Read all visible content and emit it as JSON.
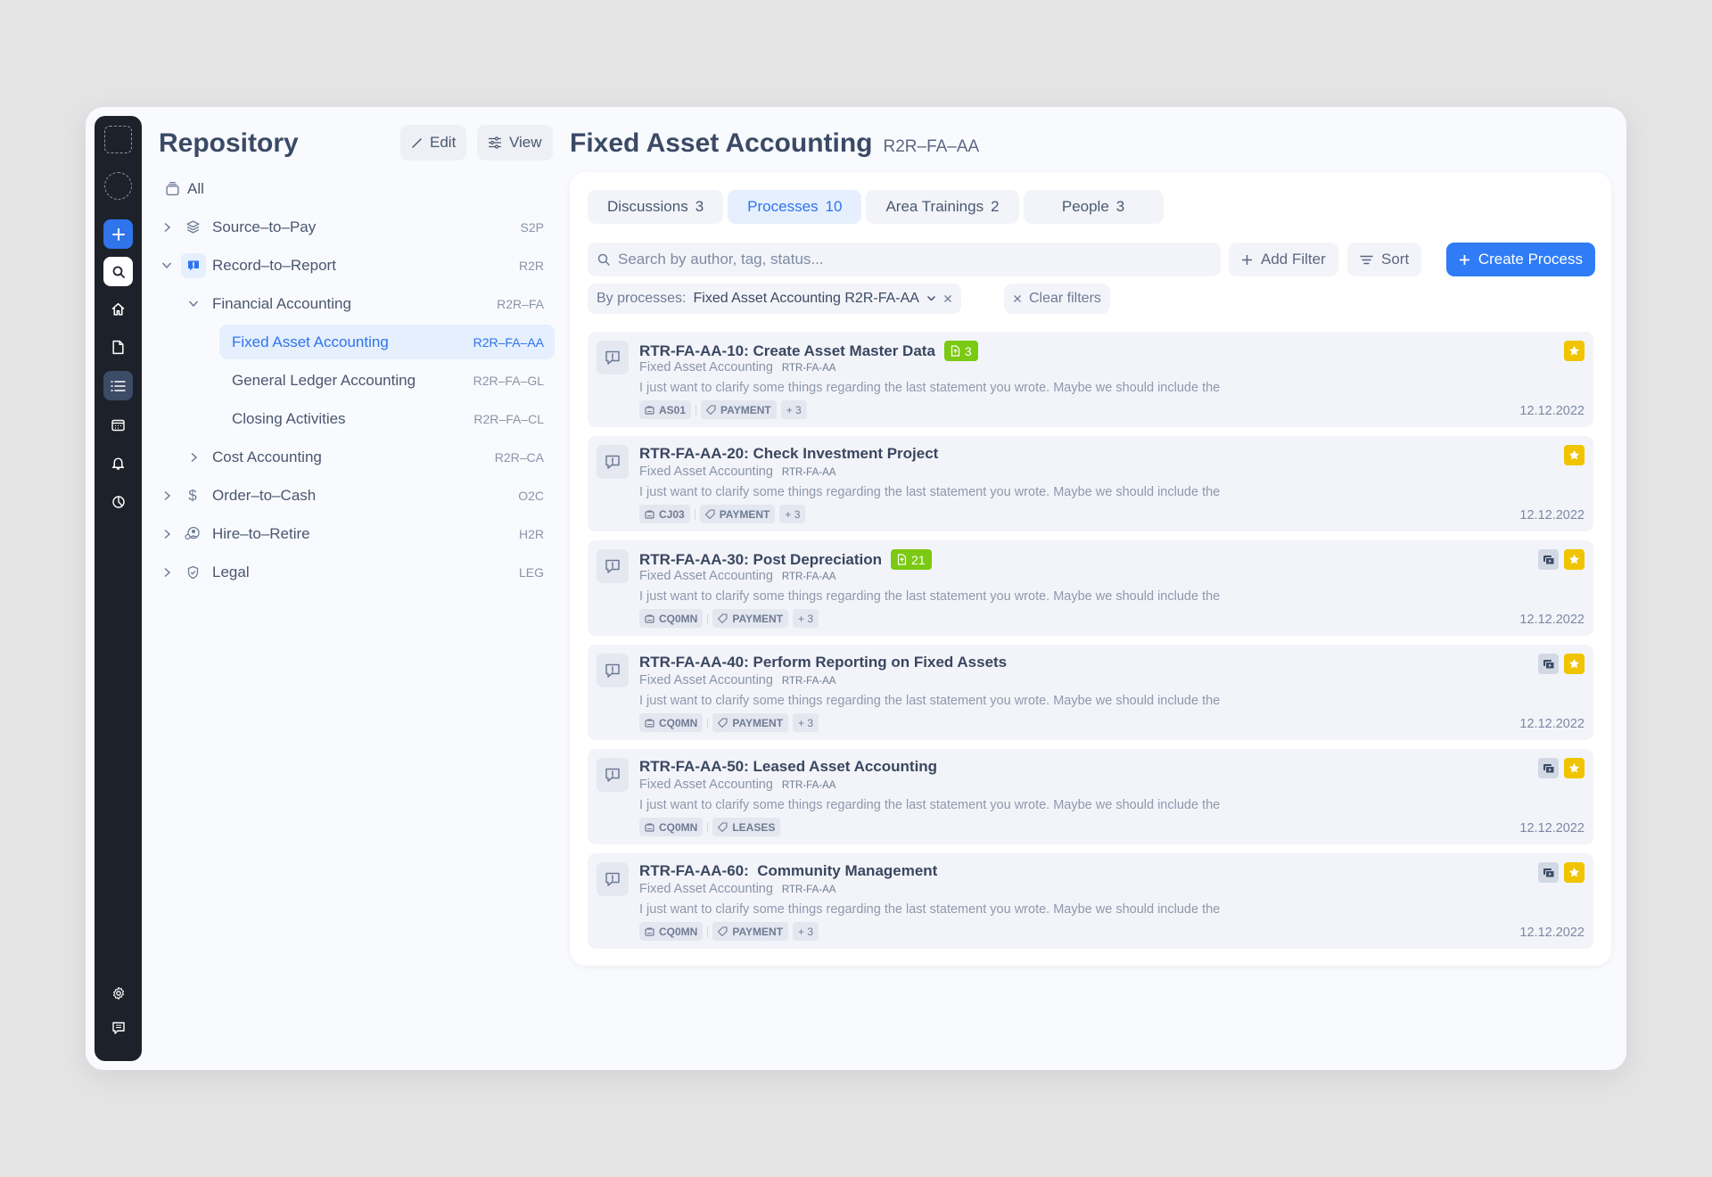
{
  "rail": {
    "items": [
      {
        "name": "workspace-placeholder",
        "icon": "dashed-square-icon"
      },
      {
        "name": "avatar-placeholder",
        "icon": "dashed-circle-icon"
      },
      {
        "name": "create",
        "icon": "plus-icon"
      },
      {
        "name": "search",
        "icon": "search-icon"
      },
      {
        "name": "home",
        "icon": "home-icon"
      },
      {
        "name": "documents",
        "icon": "file-icon"
      },
      {
        "name": "repository",
        "icon": "list-icon",
        "active": true
      },
      {
        "name": "calendar",
        "icon": "calendar-icon"
      },
      {
        "name": "notifications",
        "icon": "bell-icon"
      },
      {
        "name": "analytics",
        "icon": "pie-chart-icon"
      },
      {
        "name": "settings",
        "icon": "gear-icon"
      },
      {
        "name": "feedback",
        "icon": "message-icon"
      }
    ]
  },
  "repository": {
    "title": "Repository",
    "edit_label": "Edit",
    "view_label": "View",
    "all_label": "All",
    "tree": [
      {
        "label": "Source–to–Pay",
        "code": "S2P",
        "icon": "layers-icon",
        "expanded": false
      },
      {
        "label": "Record–to–Report",
        "code": "R2R",
        "icon": "alert-message-icon",
        "expanded": true
      },
      {
        "label": "Financial Accounting",
        "code": "R2R–FA",
        "expanded": true
      },
      {
        "label": "Fixed Asset Accounting",
        "code": "R2R–FA–AA",
        "selected": true
      },
      {
        "label": "General Ledger Accounting",
        "code": "R2R–FA–GL"
      },
      {
        "label": "Closing Activities",
        "code": "R2R–FA–CL"
      },
      {
        "label": "Cost Accounting",
        "code": "R2R–CA",
        "expanded": false
      },
      {
        "label": "Order–to–Cash",
        "code": "O2C",
        "icon": "dollar-icon",
        "expanded": false
      },
      {
        "label": "Hire–to–Retire",
        "code": "H2R",
        "icon": "user-group-icon",
        "expanded": false
      },
      {
        "label": "Legal",
        "code": "LEG",
        "icon": "shield-check-icon",
        "expanded": false
      }
    ]
  },
  "main": {
    "title": "Fixed Asset Accounting",
    "code": "R2R–FA–AA",
    "tabs": [
      {
        "label": "Discussions",
        "count": "3"
      },
      {
        "label": "Processes",
        "count": "10",
        "active": true
      },
      {
        "label": "Area Trainings",
        "count": "2"
      },
      {
        "label": "People",
        "count": "3"
      }
    ],
    "search_placeholder": "Search by author, tag, status...",
    "add_filter_label": "Add Filter",
    "sort_label": "Sort",
    "create_label": "Create Process",
    "filter": {
      "prefix": "By processes:",
      "value": "Fixed Asset Accounting R2R-FA-AA",
      "clear_label": "Clear filters"
    },
    "items": [
      {
        "title": "RTR-FA-AA-10: Create Asset Master Data",
        "badge": "3",
        "area": "Fixed Asset Accounting",
        "code": "RTR-FA-AA",
        "desc": "I just want to clarify some things regarding the last statement you wrote. Maybe we should include the",
        "system": "AS01",
        "tag": "PAYMENT",
        "more": "+ 3",
        "date": "12.12.2022",
        "video": false,
        "starred": true
      },
      {
        "title": "RTR-FA-AA-20: Check Investment Project",
        "badge": null,
        "area": "Fixed Asset Accounting",
        "code": "RTR-FA-AA",
        "desc": "I just want to clarify some things regarding the last statement you wrote. Maybe we should include the",
        "system": "CJ03",
        "tag": "PAYMENT",
        "more": "+ 3",
        "date": "12.12.2022",
        "video": false,
        "starred": true
      },
      {
        "title": "RTR-FA-AA-30: Post Depreciation",
        "badge": "21",
        "area": "Fixed Asset Accounting",
        "code": "RTR-FA-AA",
        "desc": "I just want to clarify some things regarding the last statement you wrote. Maybe we should include the",
        "system": "CQ0MN",
        "tag": "PAYMENT",
        "more": "+ 3",
        "date": "12.12.2022",
        "video": true,
        "starred": true
      },
      {
        "title": "RTR-FA-AA-40: Perform Reporting on Fixed Assets",
        "badge": null,
        "area": "Fixed Asset Accounting",
        "code": "RTR-FA-AA",
        "desc": "I just want to clarify some things regarding the last statement you wrote. Maybe we should include the",
        "system": "CQ0MN",
        "tag": "PAYMENT",
        "more": "+ 3",
        "date": "12.12.2022",
        "video": true,
        "starred": true
      },
      {
        "title": "RTR-FA-AA-50: Leased Asset Accounting",
        "badge": null,
        "area": "Fixed Asset Accounting",
        "code": "RTR-FA-AA",
        "desc": "I just want to clarify some things regarding the last statement you wrote. Maybe we should include the",
        "system": "CQ0MN",
        "tag": "LEASES",
        "more": null,
        "date": "12.12.2022",
        "video": true,
        "starred": true
      },
      {
        "title": "RTR-FA-AA-60:  Community Management",
        "badge": null,
        "area": "Fixed Asset Accounting",
        "code": "RTR-FA-AA",
        "desc": "I just want to clarify some things regarding the last statement you wrote. Maybe we should include the",
        "system": "CQ0MN",
        "tag": "PAYMENT",
        "more": "+ 3",
        "date": "12.12.2022",
        "video": true,
        "starred": true
      }
    ]
  },
  "colors": {
    "accent": "#2f7cf6",
    "rail_bg": "#1d222a",
    "badge_green": "#7bc913",
    "star_yellow": "#f0c400",
    "selected_bg": "#e5effd"
  }
}
